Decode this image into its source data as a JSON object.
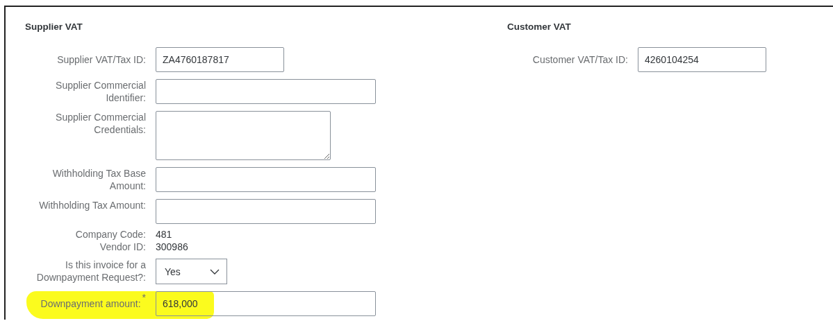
{
  "sections": [
    {
      "title": "Supplier VAT",
      "fields": [
        {
          "kind": "short-input",
          "label": "Supplier VAT/Tax ID:",
          "value": "ZA4760187817"
        },
        {
          "kind": "input",
          "label": "Supplier Commercial Identifier:"
        },
        {
          "kind": "textarea",
          "label": "Supplier Commercial Credentials:"
        },
        {
          "kind": "input",
          "label": "Withholding Tax Base Amount:"
        },
        {
          "kind": "input",
          "label": "Withholding Tax Amount:"
        },
        {
          "kind": "static",
          "label": "Company Code:",
          "value": "481"
        },
        {
          "kind": "static",
          "label": "Vendor ID:",
          "value": "300986"
        },
        {
          "kind": "select",
          "label": "Is this invoice for a Downpayment Request?:",
          "value": "Yes"
        },
        {
          "kind": "input",
          "label": "Downpayment amount:",
          "value": "618,000",
          "required_mark": "*",
          "highlighted": true
        }
      ]
    },
    {
      "title": "Customer VAT",
      "fields": [
        {
          "kind": "short-input",
          "label": "Customer VAT/Tax ID:",
          "value": "4260104254"
        }
      ]
    }
  ]
}
